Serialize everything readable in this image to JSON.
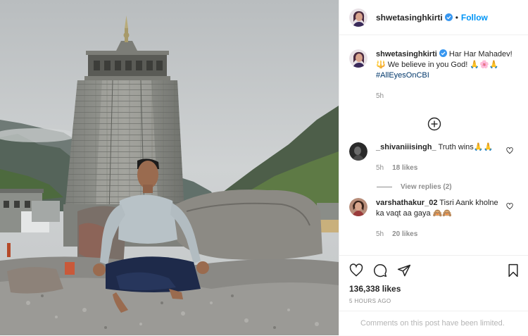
{
  "post": {
    "photo_alt": "",
    "author": {
      "username": "shwetasinghkirti",
      "avatar_icon": "profile-avatar",
      "verified": true
    },
    "header": {
      "separator": "•",
      "follow_label": "Follow"
    },
    "caption": {
      "username": "shwetasinghkirti",
      "text_1": " Har Har Mahadev!",
      "text_2": "🔱 We believe in you God! 🙏🌸🙏",
      "hashtag": "#AllEyesOnCBI",
      "time": "5h"
    },
    "load_more_icon": "plus-circle-icon",
    "comments": [
      {
        "username": "_shivaniiisingh_",
        "text": " Truth wins🙏🙏",
        "time": "5h",
        "likes": "18 likes",
        "view_replies": "View replies (2)"
      },
      {
        "username": "varshathakur_02",
        "text": " Tisri Aank kholne ka vaqt aa gaya 🙈🙈",
        "time": "5h",
        "likes": "20 likes"
      }
    ],
    "likes_count": "136,338 likes",
    "time_ago": "5 HOURS AGO",
    "comments_limited": "Comments on this post have been limited.",
    "colors": {
      "accent": "#0095f6",
      "text": "#262626",
      "muted": "#8e8e8e",
      "border": "#efefef"
    }
  }
}
